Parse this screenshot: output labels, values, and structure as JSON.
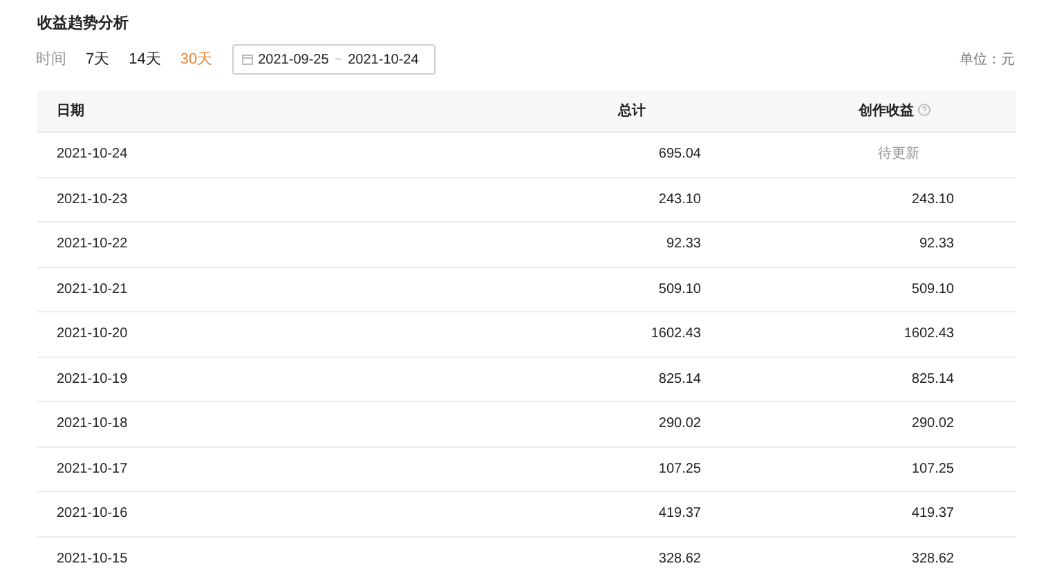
{
  "title": "收益趋势分析",
  "filter": {
    "label": "时间",
    "ranges": [
      {
        "label": "7天",
        "selected": false
      },
      {
        "label": "14天",
        "selected": false
      },
      {
        "label": "30天",
        "selected": true
      }
    ],
    "date_range": {
      "start": "2021-09-25",
      "separator": "~",
      "end": "2021-10-24"
    }
  },
  "unit": "单位：元",
  "table": {
    "columns": [
      "日期",
      "总计",
      "创作收益"
    ],
    "rows": [
      {
        "date": "2021-10-24",
        "total": "695.04",
        "creation": "待更新",
        "pending": true
      },
      {
        "date": "2021-10-23",
        "total": "243.10",
        "creation": "243.10",
        "pending": false
      },
      {
        "date": "2021-10-22",
        "total": "92.33",
        "creation": "92.33",
        "pending": false
      },
      {
        "date": "2021-10-21",
        "total": "509.10",
        "creation": "509.10",
        "pending": false
      },
      {
        "date": "2021-10-20",
        "total": "1602.43",
        "creation": "1602.43",
        "pending": false
      },
      {
        "date": "2021-10-19",
        "total": "825.14",
        "creation": "825.14",
        "pending": false
      },
      {
        "date": "2021-10-18",
        "total": "290.02",
        "creation": "290.02",
        "pending": false
      },
      {
        "date": "2021-10-17",
        "total": "107.25",
        "creation": "107.25",
        "pending": false
      },
      {
        "date": "2021-10-16",
        "total": "419.37",
        "creation": "419.37",
        "pending": false
      },
      {
        "date": "2021-10-15",
        "total": "328.62",
        "creation": "328.62",
        "pending": false
      }
    ]
  }
}
